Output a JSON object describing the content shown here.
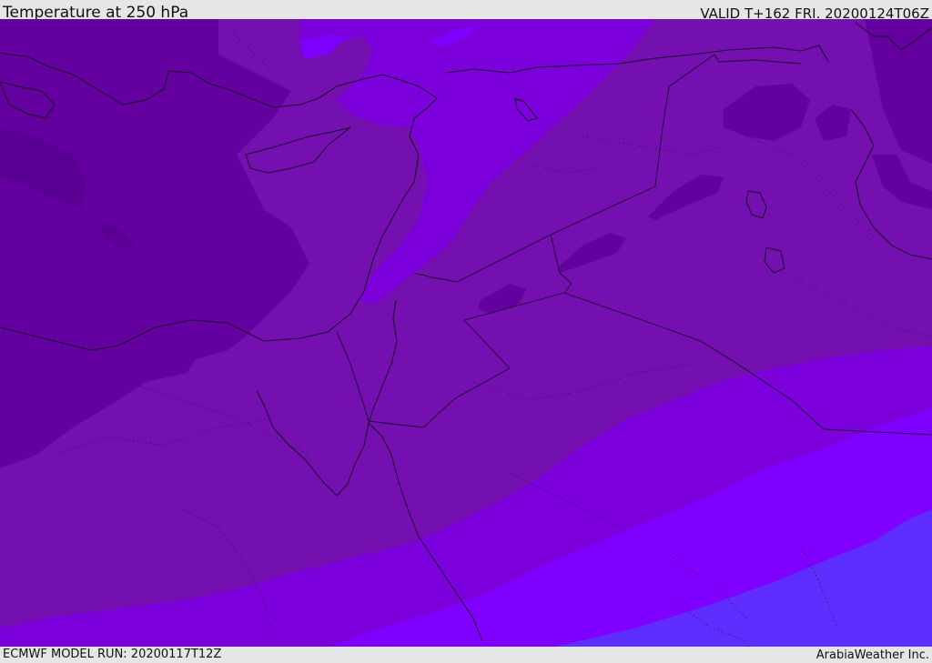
{
  "header": {
    "title": "Temperature at 250 hPa",
    "valid": "VALID T+162 FRI. 20200124T06Z"
  },
  "footer": {
    "model_run": "ECMWF MODEL RUN: 20200117T12Z",
    "credit": "ArabiaWeather Inc."
  },
  "map": {
    "colors": {
      "coldest": "#6400a0",
      "cold": "#7410b0",
      "mid": "#7b00dc",
      "warm": "#8000ff",
      "warmest": "#5e2dff",
      "coast": "#1a0a2a",
      "border": "#1a0a2a"
    }
  }
}
